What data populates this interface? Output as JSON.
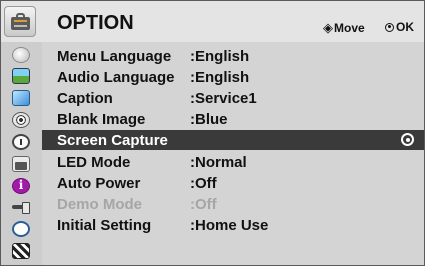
{
  "header": {
    "title": "OPTION",
    "icon": "option-toolbox-icon",
    "hints": {
      "move_icon": "◈",
      "move_label": "Move",
      "ok_label": "OK"
    }
  },
  "sidebar": {
    "icons": [
      "satellite-dish-icon",
      "picture-icon",
      "screen-icon",
      "disc-icon",
      "clock-icon",
      "option-icon",
      "info-icon",
      "input-plug-icon",
      "timer-icon",
      "clapperboard-icon"
    ],
    "selected_icon": "option-icon"
  },
  "menu": {
    "items": [
      {
        "label": "Menu Language",
        "value": ":English",
        "state": "normal"
      },
      {
        "label": "Audio Language",
        "value": ":English",
        "state": "normal"
      },
      {
        "label": "Caption",
        "value": ":Service1",
        "state": "normal"
      },
      {
        "label": "Blank Image",
        "value": ":Blue",
        "state": "normal"
      },
      {
        "label": "Screen Capture",
        "value": "",
        "state": "selected"
      },
      {
        "label": "LED Mode",
        "value": ":Normal",
        "state": "normal"
      },
      {
        "label": "Auto Power",
        "value": ":Off",
        "state": "normal"
      },
      {
        "label": "Demo Mode",
        "value": ":Off",
        "state": "disabled"
      },
      {
        "label": "Initial Setting",
        "value": ":Home Use",
        "state": "normal"
      }
    ]
  },
  "colors": {
    "background": "#d4d4d4",
    "selected_row": "#3a3a3a",
    "disabled_text": "#a6a6a6",
    "text": "#111111"
  }
}
